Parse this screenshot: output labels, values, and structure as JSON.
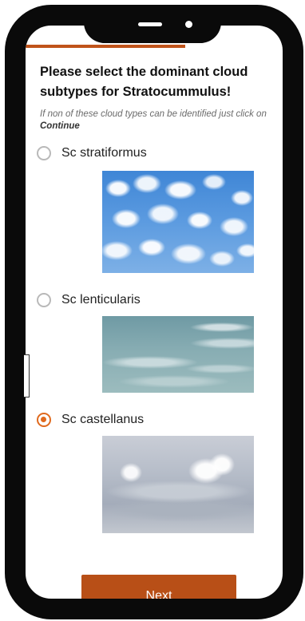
{
  "progress": {
    "value": 0.62
  },
  "question": {
    "title": "Please select the dominant cloud subtypes for Stratocummulus!",
    "hint_prefix": "If non of these cloud types can be identified just click on",
    "hint_action": "Continue"
  },
  "options": [
    {
      "label": "Sc stratiformus",
      "selected": false
    },
    {
      "label": "Sc lenticularis",
      "selected": false
    },
    {
      "label": "Sc castellanus",
      "selected": true
    }
  ],
  "next_button": {
    "label": "Next"
  },
  "colors": {
    "accent": "#e06a1e",
    "button": "#b84f17",
    "progress": "#c0531a"
  }
}
